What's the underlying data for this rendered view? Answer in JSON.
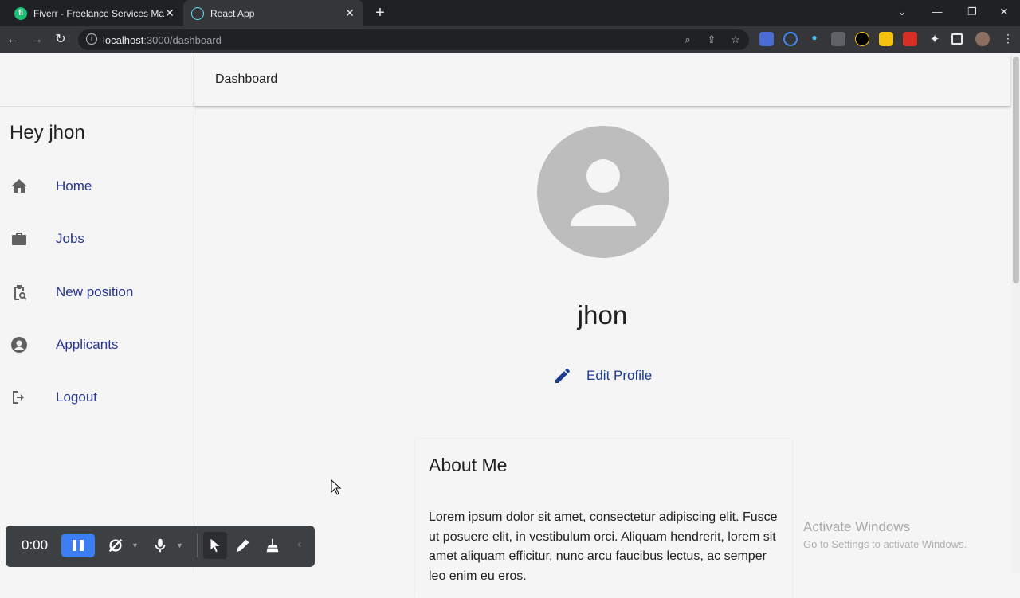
{
  "browser": {
    "tabs": [
      {
        "title": "Fiverr - Freelance Services Marke",
        "favicon": "fiverr-icon",
        "active": false
      },
      {
        "title": "React App",
        "favicon": "react-icon",
        "active": true
      }
    ],
    "url_host": "localhost",
    "url_path": ":3000/dashboard"
  },
  "topbar": {
    "title": "Dashboard"
  },
  "sidebar": {
    "greeting": "Hey jhon",
    "items": [
      {
        "label": "Home",
        "icon": "home-icon"
      },
      {
        "label": "Jobs",
        "icon": "briefcase-icon"
      },
      {
        "label": "New position",
        "icon": "clipboard-search-icon"
      },
      {
        "label": "Applicants",
        "icon": "account-circle-icon"
      },
      {
        "label": "Logout",
        "icon": "logout-icon"
      }
    ]
  },
  "profile": {
    "name": "jhon",
    "edit_label": "Edit Profile"
  },
  "about": {
    "heading": "About Me",
    "text": "Lorem ipsum dolor sit amet, consectetur adipiscing elit. Fusce ut posuere elit, in vestibulum orci. Aliquam hendrerit, lorem sit amet aliquam efficitur, nunc arcu faucibus lectus, ac semper leo enim eu eros."
  },
  "watermark": {
    "line1": "Activate Windows",
    "line2": "Go to Settings to activate Windows."
  },
  "recorder": {
    "time": "0:00"
  },
  "colors": {
    "nav_link": "#283593",
    "edit_link": "#1a3d8f",
    "avatar_bg": "#bdbdbd",
    "recorder_pause": "#3d7ef5"
  }
}
